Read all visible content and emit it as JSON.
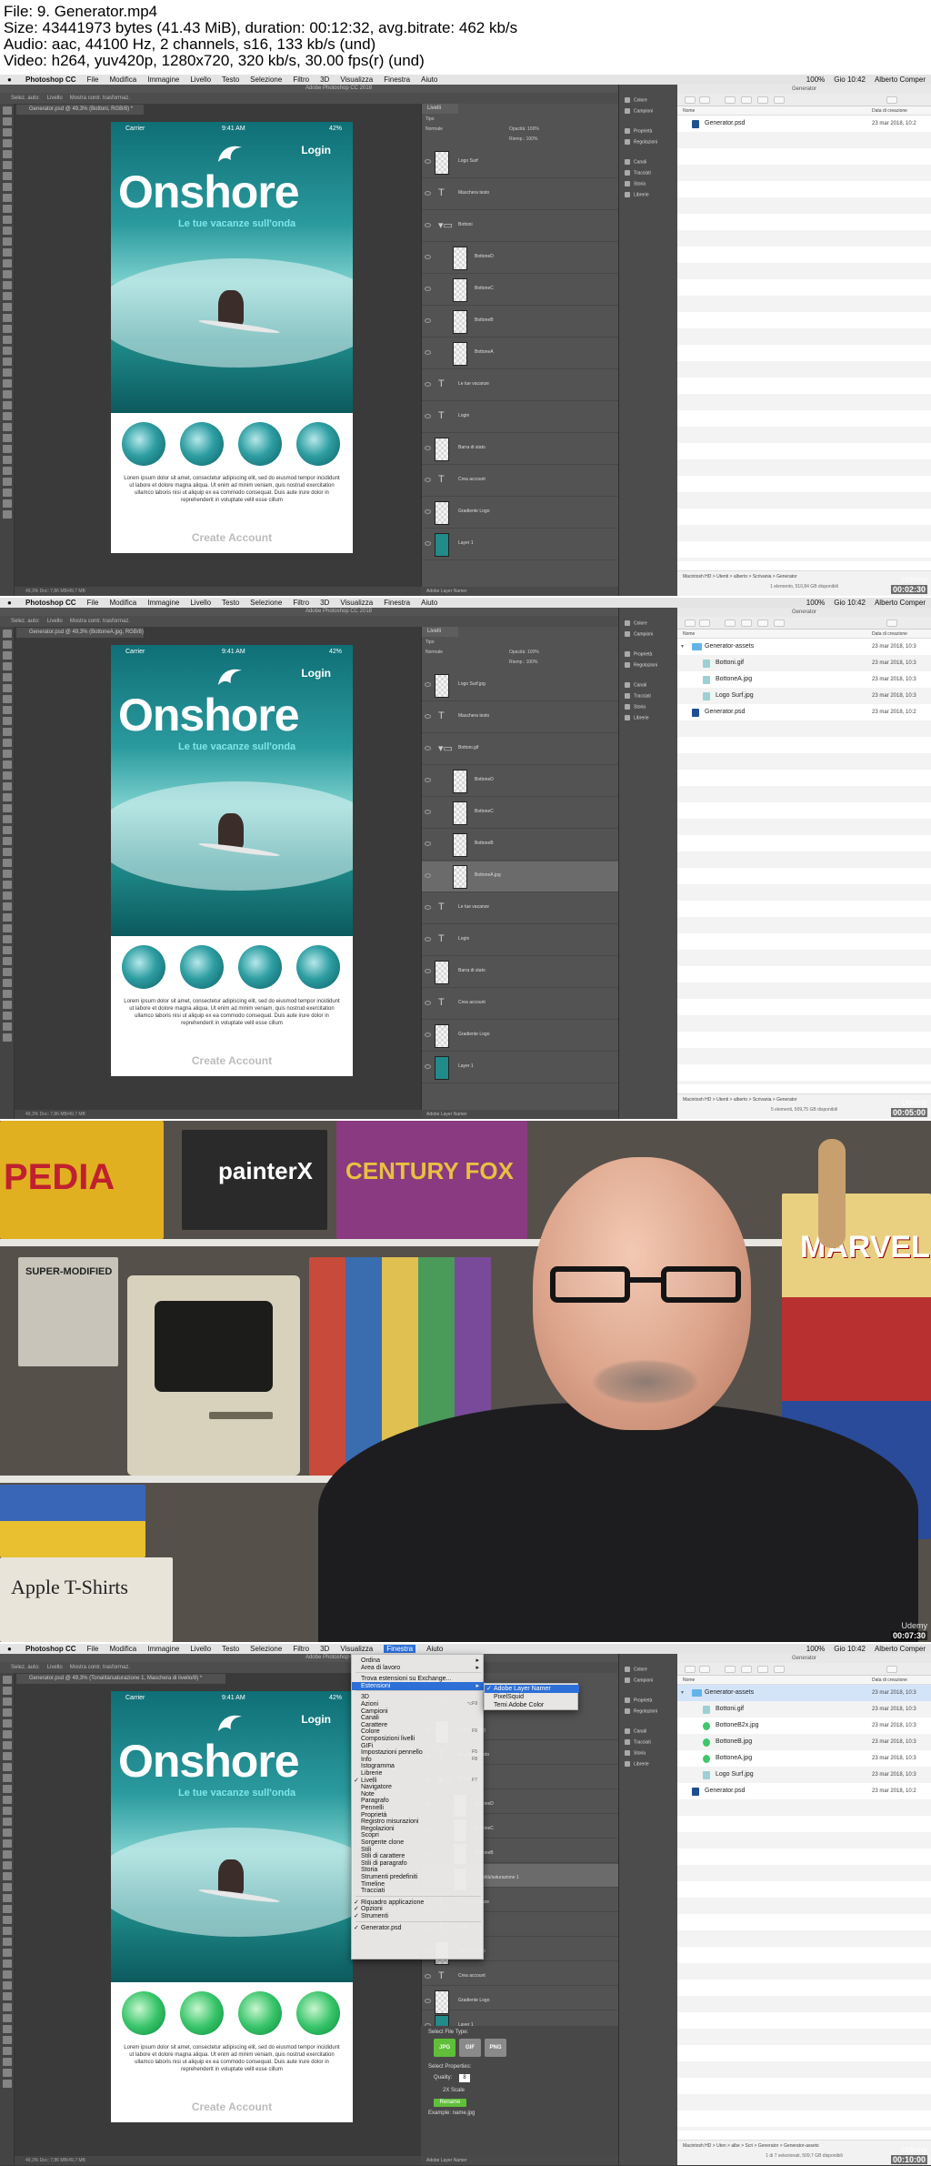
{
  "header": {
    "lines": [
      "File: 9. Generator.mp4",
      "Size: 43441973 bytes (41.43 MiB), duration: 00:12:32, avg.bitrate: 462 kb/s",
      "Audio: aac, 44100 Hz, 2 channels, s16, 133 kb/s (und)",
      "Video: h264, yuv420p, 1280x720, 320 kb/s, 30.00 fps(r) (und)"
    ]
  },
  "menubar": {
    "apple": "",
    "items": [
      "Photoshop CC",
      "File",
      "Modifica",
      "Immagine",
      "Livello",
      "Testo",
      "Selezione",
      "Filtro",
      "3D",
      "Visualizza",
      "Finestra",
      "Aiuto"
    ],
    "right": [
      "100%",
      "Gio 10:42",
      "Alberto Comper"
    ]
  },
  "photoshop": {
    "window_title": "Adobe Photoshop CC 2018",
    "options_bar": [
      "Selez. auto:",
      "Livello",
      "Mostra contr. trasformaz."
    ],
    "doc_tabs": [
      "Generator.psd @ 49,3% (Bottoni, RGB/8) *",
      "Generator.psd @ 49,3% (BottoneA.jpg, RGB/8) *",
      "",
      "Generator.psd @ 49,3% (Tonalità/saturazione 1, Maschera di livello/8) *"
    ],
    "status": "49,3%   Doc: 7,86 MB/49,7 MB",
    "layers_tab": "Livelli",
    "filter_label": "Tipo",
    "blend_mode": "Normale",
    "opacity_label": "Opacità:",
    "opacity_value": "100%",
    "fill_label": "Riemp.:",
    "fill_value": "100%",
    "panel_footer": "Adobe Layer Namer"
  },
  "mockup": {
    "carrier": "Carrier",
    "time": "9:41 AM",
    "battery": "42%",
    "login": "Login",
    "brand": "Onshore",
    "tagline": "Le tue vacanze sull'onda",
    "lorem": "Lorem ipsum dolor sit amet, consectetur adipiscing elit, sed do eiusmod tempor incididunt ut labore et dolore magna aliqua. Ut enim ad minim veniam, quis nostrud exercitation ullamco laboris nisi ut aliquip ex ea commodo consequat. Duis aute irure dolor in reprehenderit in voluptate velit esse cillum",
    "create_account": "Create Account"
  },
  "layers": {
    "frame1": [
      {
        "name": "Logo Surf",
        "type": "pixel"
      },
      {
        "name": "Maschera testo",
        "type": "text"
      },
      {
        "name": "Bottoni",
        "type": "group"
      },
      {
        "name": "BottoneD",
        "type": "pixel",
        "indent": true
      },
      {
        "name": "BottoneC",
        "type": "pixel",
        "indent": true
      },
      {
        "name": "BottoneB",
        "type": "pixel",
        "indent": true
      },
      {
        "name": "BottoneA",
        "type": "pixel",
        "indent": true
      },
      {
        "name": "Le tue vacanze",
        "type": "text"
      },
      {
        "name": "Login",
        "type": "text"
      },
      {
        "name": "Barra di stato",
        "type": "pixel"
      },
      {
        "name": "Crea account",
        "type": "text"
      },
      {
        "name": "Gradiente Logo",
        "type": "pixel"
      },
      {
        "name": "Layer 1",
        "type": "image"
      }
    ],
    "frame2": [
      {
        "name": "Logo Surf.jpg",
        "type": "pixel"
      },
      {
        "name": "Maschera testo",
        "type": "text"
      },
      {
        "name": "Bottoni.gif",
        "type": "group"
      },
      {
        "name": "BottoneD",
        "type": "pixel",
        "indent": true
      },
      {
        "name": "BottoneC",
        "type": "pixel",
        "indent": true
      },
      {
        "name": "BottoneB",
        "type": "pixel",
        "indent": true
      },
      {
        "name": "BottoneA.jpg",
        "type": "pixel",
        "indent": true,
        "selected": true
      },
      {
        "name": "Le tue vacanze",
        "type": "text"
      },
      {
        "name": "Login",
        "type": "text"
      },
      {
        "name": "Barra di stato",
        "type": "pixel"
      },
      {
        "name": "Crea account",
        "type": "text"
      },
      {
        "name": "Gradiente Logo",
        "type": "pixel"
      },
      {
        "name": "Layer 1",
        "type": "image"
      }
    ],
    "frame4_selected": "Tonalità/saturazione 1"
  },
  "mini_panels": [
    "Colore",
    "Campioni",
    "Proprietà",
    "Regolazioni",
    "Canali",
    "Tracciati",
    "Storia",
    "Librerie"
  ],
  "finder": {
    "title": "Generator",
    "col_name": "Nome",
    "col_date": "Data di creazione",
    "frame1_rows": [
      {
        "name": "Generator.psd",
        "date": "23 mar 2018, 10:2",
        "kind": "psd",
        "level": 0
      }
    ],
    "frame2_rows": [
      {
        "name": "Generator-assets",
        "date": "23 mar 2018, 10:3",
        "kind": "folder",
        "level": 0,
        "open": true
      },
      {
        "name": "Bottoni.gif",
        "date": "23 mar 2018, 10:3",
        "kind": "img",
        "level": 1
      },
      {
        "name": "BottoneA.jpg",
        "date": "23 mar 2018, 10:3",
        "kind": "img",
        "level": 1
      },
      {
        "name": "Logo Surf.jpg",
        "date": "23 mar 2018, 10:3",
        "kind": "img",
        "level": 1
      },
      {
        "name": "Generator.psd",
        "date": "23 mar 2018, 10:2",
        "kind": "psd",
        "level": 0
      }
    ],
    "frame4_rows": [
      {
        "name": "Generator-assets",
        "date": "23 mar 2018, 10:3",
        "kind": "folder",
        "level": 0,
        "open": true,
        "selected": true
      },
      {
        "name": "Bottoni.gif",
        "date": "23 mar 2018, 10:3",
        "kind": "img",
        "level": 1
      },
      {
        "name": "BottoneB2x.jpg",
        "date": "23 mar 2018, 10:3",
        "kind": "imgg",
        "level": 1
      },
      {
        "name": "BottoneB.jpg",
        "date": "23 mar 2018, 10:3",
        "kind": "imgg",
        "level": 1
      },
      {
        "name": "BottoneA.jpg",
        "date": "23 mar 2018, 10:3",
        "kind": "imgg",
        "level": 1
      },
      {
        "name": "Logo Surf.jpg",
        "date": "23 mar 2018, 10:3",
        "kind": "img",
        "level": 1
      },
      {
        "name": "Generator.psd",
        "date": "23 mar 2018, 10:2",
        "kind": "psd",
        "level": 0
      }
    ],
    "path1": "Macintosh HD  >  Utenti  >  alberto  >  Scrivania  >  Generator",
    "path4": "Macintosh HD  >  Uten  >  albe  >  Scri  >  Generator  >  Generator-assets",
    "count1": "1 elemento, 510,84 GB disponibili",
    "count2": "5 elementi, 509,75 GB disponibili",
    "count4": "1 di 7 selezionati, 509,7 GB disponibili"
  },
  "timecodes": [
    "00:02:30",
    "00:05:00",
    "00:07:30",
    "00:10:00"
  ],
  "watermark": "Udemy",
  "window_menu": {
    "items": [
      {
        "label": "Ordina",
        "arrow": true
      },
      {
        "label": "Area di lavoro",
        "arrow": true
      },
      {
        "sep": true
      },
      {
        "label": "Trova estensioni su Exchange..."
      },
      {
        "label": "Estensioni",
        "arrow": true,
        "highlight": true
      },
      {
        "sep": true
      },
      {
        "label": "3D"
      },
      {
        "label": "Azioni",
        "sc": "⌥F9"
      },
      {
        "label": "Campioni"
      },
      {
        "label": "Canali"
      },
      {
        "label": "Carattere"
      },
      {
        "label": "Colore",
        "sc": "F6"
      },
      {
        "label": "Composizioni livelli"
      },
      {
        "label": "GIFi"
      },
      {
        "label": "Impostazioni pennello",
        "sc": "F5"
      },
      {
        "label": "Info",
        "sc": "F8"
      },
      {
        "label": "Istogramma"
      },
      {
        "label": "Librerie"
      },
      {
        "label": "Livelli",
        "check": true,
        "sc": "F7"
      },
      {
        "label": "Navigatore"
      },
      {
        "label": "Note"
      },
      {
        "label": "Paragrafo"
      },
      {
        "label": "Pennelli"
      },
      {
        "label": "Proprietà"
      },
      {
        "label": "Registro misurazioni"
      },
      {
        "label": "Regolazioni"
      },
      {
        "label": "Scopri"
      },
      {
        "label": "Sorgente clone"
      },
      {
        "label": "Stili"
      },
      {
        "label": "Stili di carattere"
      },
      {
        "label": "Stili di paragrafo"
      },
      {
        "label": "Storia"
      },
      {
        "label": "Strumenti predefiniti"
      },
      {
        "label": "Timeline"
      },
      {
        "label": "Tracciati"
      },
      {
        "sep": true
      },
      {
        "label": "Riquadro applicazione",
        "check": true
      },
      {
        "label": "Opzioni",
        "check": true
      },
      {
        "label": "Strumenti",
        "check": true
      },
      {
        "sep": true
      },
      {
        "label": "Generator.psd",
        "check": true
      }
    ],
    "submenu": [
      {
        "label": "Adobe Layer Namer",
        "check": true,
        "highlight": true
      },
      {
        "label": "PixelSquid"
      },
      {
        "label": "Temi Adobe Color"
      }
    ]
  },
  "generator_panel": {
    "file_type_label": "Select File Type:",
    "file_types": [
      "JPG",
      "GIF",
      "PNG"
    ],
    "properties_label": "Select Properties:",
    "quality_label": "Quality:",
    "quality_value": "8",
    "retina_label": "2X Scale",
    "rename_button": "Rename",
    "example": "Example: name.jpg"
  },
  "studio": {
    "posters": [
      "PEDIA",
      "painterX",
      "CENTURY FOX",
      "SUPER-MODIFIED",
      "MARVEL",
      "Apple T-Shirts"
    ]
  },
  "colors": {
    "ps_dark": "#3a3a3a",
    "ps_panel": "#535353",
    "menu_highlight": "#2d6fd6",
    "generator_green": "#5fbf39",
    "brand_cyan": "#7fe6ea"
  }
}
